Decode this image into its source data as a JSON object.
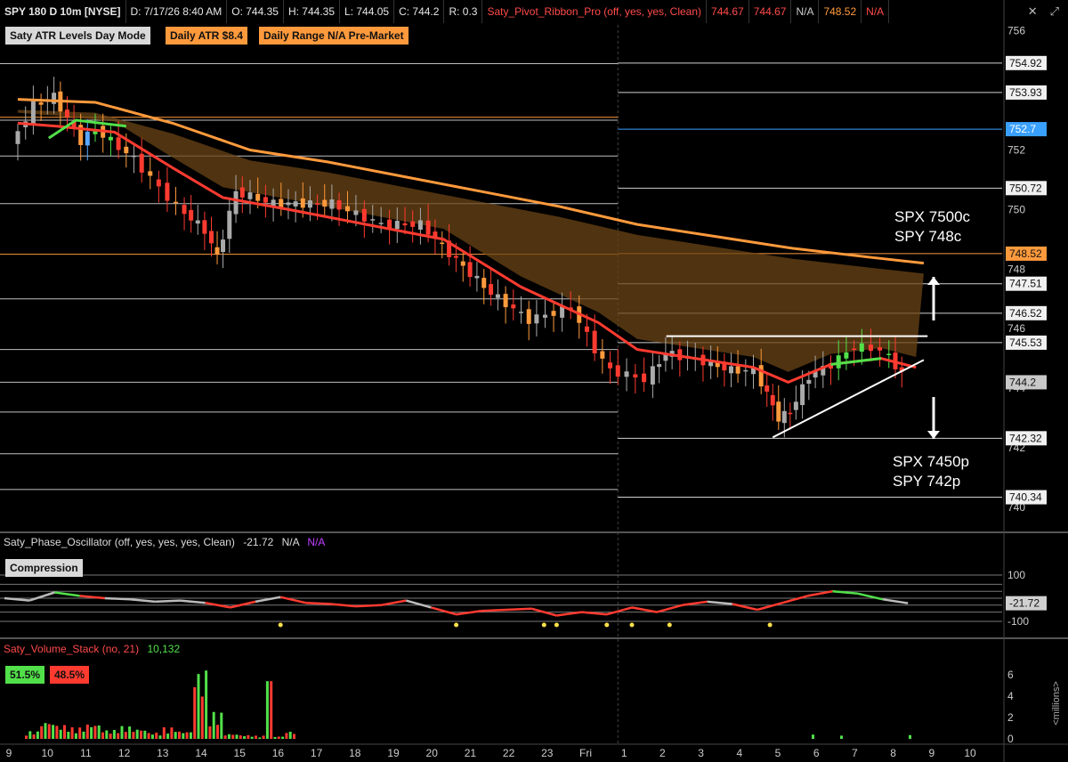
{
  "header": {
    "symbol": "SPY 180 D 10m [NYSE]",
    "date": "D: 7/17/26 8:40 AM",
    "open": "O: 744.35",
    "high": "H: 744.35",
    "low": "L: 744.05",
    "close": "C: 744.2",
    "range": "R: 0.3",
    "ribbon_name": "Saty_Pivot_Ribbon_Pro (off, yes, yes, Clean)",
    "ribbon_v1": "744.67",
    "ribbon_v2": "744.67",
    "ribbon_v3": "N/A",
    "ribbon_v4": "748.52",
    "ribbon_v5": "N/A"
  },
  "chips": {
    "atr_mode": "Saty ATR Levels Day Mode",
    "daily_atr": "Daily ATR $8.4",
    "daily_range": "Daily Range N/A Pre-Market"
  },
  "annotations": {
    "call_line1": "SPX 7500c",
    "call_line2": "SPY 748c",
    "put_line1": "SPX 7450p",
    "put_line2": "SPY 742p"
  },
  "oscillator": {
    "name": "Saty_Phase_Oscillator (off, yes, yes, yes, Clean)",
    "value": "-21.72",
    "na1": "N/A",
    "na2": "N/A",
    "compression": "Compression",
    "ticks": [
      "100",
      "-100"
    ],
    "last": "-21.72"
  },
  "volume": {
    "name": "Saty_Volume_Stack (no, 21)",
    "value": "10,132",
    "buy_pct": "51.5%",
    "sell_pct": "48.5%",
    "axis_unit": "<millions>",
    "ticks": [
      "6",
      "4",
      "2",
      "0"
    ]
  },
  "x_axis": {
    "labels": [
      "9",
      "10",
      "11",
      "12",
      "13",
      "14",
      "15",
      "16",
      "17",
      "18",
      "19",
      "20",
      "21",
      "22",
      "23",
      "Fri",
      "1",
      "2",
      "3",
      "4",
      "5",
      "6",
      "7",
      "8",
      "9",
      "10"
    ]
  },
  "colors": {
    "background": "#000000",
    "orange": "#ff9a3c",
    "red": "#ff3b30",
    "green": "#52e04a",
    "blue_level": "#3aa0ff",
    "ribbon_brown": "#6b4416"
  },
  "chart_data": {
    "type": "candlestick",
    "y_ticks": [
      "756",
      "752",
      "750",
      "748",
      "746",
      "744",
      "742",
      "740"
    ],
    "ylim": [
      739.4,
      756.2
    ],
    "level_labels": [
      "754.92",
      "753.93",
      "752.7",
      "750.72",
      "748.52",
      "747.51",
      "746.52",
      "745.53",
      "744.2",
      "742.32",
      "740.34"
    ],
    "levels": [
      754.92,
      753.93,
      752.7,
      750.72,
      748.52,
      747.51,
      746.52,
      745.53,
      742.32,
      740.34
    ],
    "prior_levels": [
      754.9,
      753.0,
      751.8,
      750.2,
      748.5,
      747.0,
      745.3,
      744.2,
      743.2,
      741.8,
      740.6
    ],
    "price_path": [
      [
        0,
        752.2
      ],
      [
        0.6,
        753.5
      ],
      [
        1.1,
        753.8
      ],
      [
        1.8,
        752.3
      ],
      [
        2.2,
        752.7
      ],
      [
        3.2,
        751.7
      ],
      [
        4.3,
        750.1
      ],
      [
        5.0,
        749.3
      ],
      [
        5.3,
        748.4
      ],
      [
        5.8,
        750.6
      ],
      [
        6.8,
        750.2
      ],
      [
        8.3,
        750.2
      ],
      [
        9.6,
        749.5
      ],
      [
        10.6,
        749.5
      ],
      [
        11.5,
        748.3
      ],
      [
        12.4,
        747.2
      ],
      [
        13.4,
        746.3
      ],
      [
        14.5,
        746.7
      ],
      [
        15.1,
        745.3
      ],
      [
        15.5,
        744.6
      ],
      [
        16.4,
        744.3
      ],
      [
        16.9,
        745.2
      ],
      [
        17.9,
        744.9
      ],
      [
        18.6,
        744.6
      ],
      [
        19.2,
        744.6
      ],
      [
        19.5,
        743.8
      ],
      [
        19.8,
        743.0
      ],
      [
        20.1,
        743.2
      ],
      [
        20.6,
        744.4
      ],
      [
        21.2,
        744.8
      ],
      [
        21.8,
        745.4
      ],
      [
        22.5,
        745.3
      ],
      [
        23.0,
        744.5
      ]
    ],
    "sma200": [
      [
        0,
        753.7
      ],
      [
        2,
        753.6
      ],
      [
        4,
        752.9
      ],
      [
        6,
        752.0
      ],
      [
        8,
        751.6
      ],
      [
        10,
        751.1
      ],
      [
        12,
        750.6
      ],
      [
        14,
        750.1
      ],
      [
        16,
        749.5
      ],
      [
        18,
        749.1
      ],
      [
        20,
        748.7
      ],
      [
        22,
        748.4
      ],
      [
        23.4,
        748.2
      ]
    ],
    "ema_ribbon": [
      [
        0,
        752.9
      ],
      [
        1,
        752.8
      ],
      [
        2.5,
        752.6
      ],
      [
        4,
        751.4
      ],
      [
        5.3,
        750.4
      ],
      [
        7,
        750.0
      ],
      [
        9,
        749.5
      ],
      [
        11,
        749.0
      ],
      [
        13,
        747.4
      ],
      [
        15,
        746.2
      ],
      [
        16,
        745.3
      ],
      [
        17.5,
        745.0
      ],
      [
        19,
        744.7
      ],
      [
        19.9,
        744.2
      ],
      [
        21,
        744.8
      ],
      [
        22.3,
        745.0
      ],
      [
        23.2,
        744.7
      ]
    ],
    "trendline_support": [
      [
        19.5,
        742.35
      ],
      [
        23.4,
        744.95
      ]
    ],
    "resistance": [
      [
        16.75,
        745.75
      ],
      [
        23.5,
        745.75
      ]
    ],
    "volume_millions": [
      0.6,
      1.4,
      1.1,
      0.9,
      1.2,
      0.7,
      1.0,
      0.8,
      0.5,
      0.9,
      0.6,
      5.4,
      2.1,
      0.4,
      0.3,
      0.25,
      0.2
    ],
    "oscillator_values": [
      0,
      -10,
      25,
      10,
      0,
      -5,
      -15,
      -10,
      -20,
      -40,
      -15,
      5,
      -20,
      -25,
      -35,
      -30,
      -10,
      -40,
      -70,
      -55,
      -50,
      -45,
      -75,
      -60,
      -70,
      -40,
      -60,
      -30,
      -15,
      -25,
      -50,
      -20,
      10,
      30,
      20,
      -5,
      -21.72
    ]
  }
}
